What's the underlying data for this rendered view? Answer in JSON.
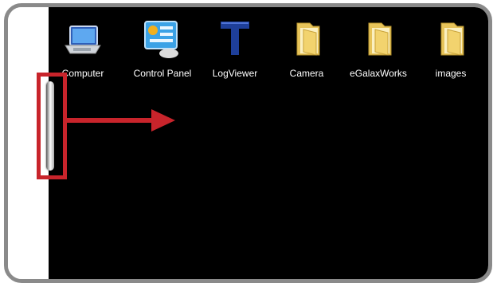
{
  "desktop_icons": [
    {
      "label": "Computer",
      "icon": "computer-icon"
    },
    {
      "label": "Control Panel",
      "icon": "control-panel-icon"
    },
    {
      "label": "LogViewer",
      "icon": "logviewer-icon"
    },
    {
      "label": "Camera",
      "icon": "folder-icon"
    },
    {
      "label": "eGalaxWorks",
      "icon": "folder-icon"
    },
    {
      "label": "images",
      "icon": "folder-icon"
    }
  ],
  "annotation": {
    "highlight_color": "#c8242b",
    "arrow_color": "#c8242b",
    "arrow_direction": "right"
  }
}
